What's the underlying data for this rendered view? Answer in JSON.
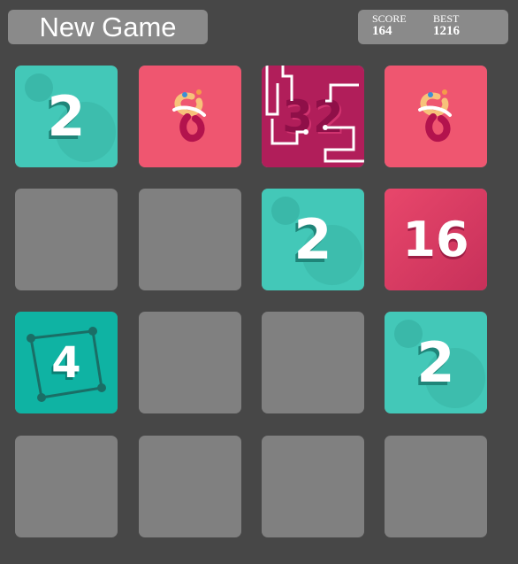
{
  "header": {
    "new_game_label": "New Game",
    "score_label": "SCORE",
    "score_value": "164",
    "best_label": "BEST",
    "best_value": "1216"
  },
  "board": {
    "rows": [
      [
        "2",
        "8",
        "32",
        "8"
      ],
      [
        "",
        "",
        "2",
        "16"
      ],
      [
        "4",
        "",
        "",
        "2"
      ],
      [
        "",
        "",
        "",
        ""
      ]
    ]
  },
  "colors": {
    "background": "#474747",
    "empty_cell": "#808080",
    "tile_2": "#43c8b8",
    "tile_4": "#0fb3a3",
    "tile_8": "#ef5670",
    "tile_16": "#e0406a",
    "tile_32": "#b11e5a"
  }
}
